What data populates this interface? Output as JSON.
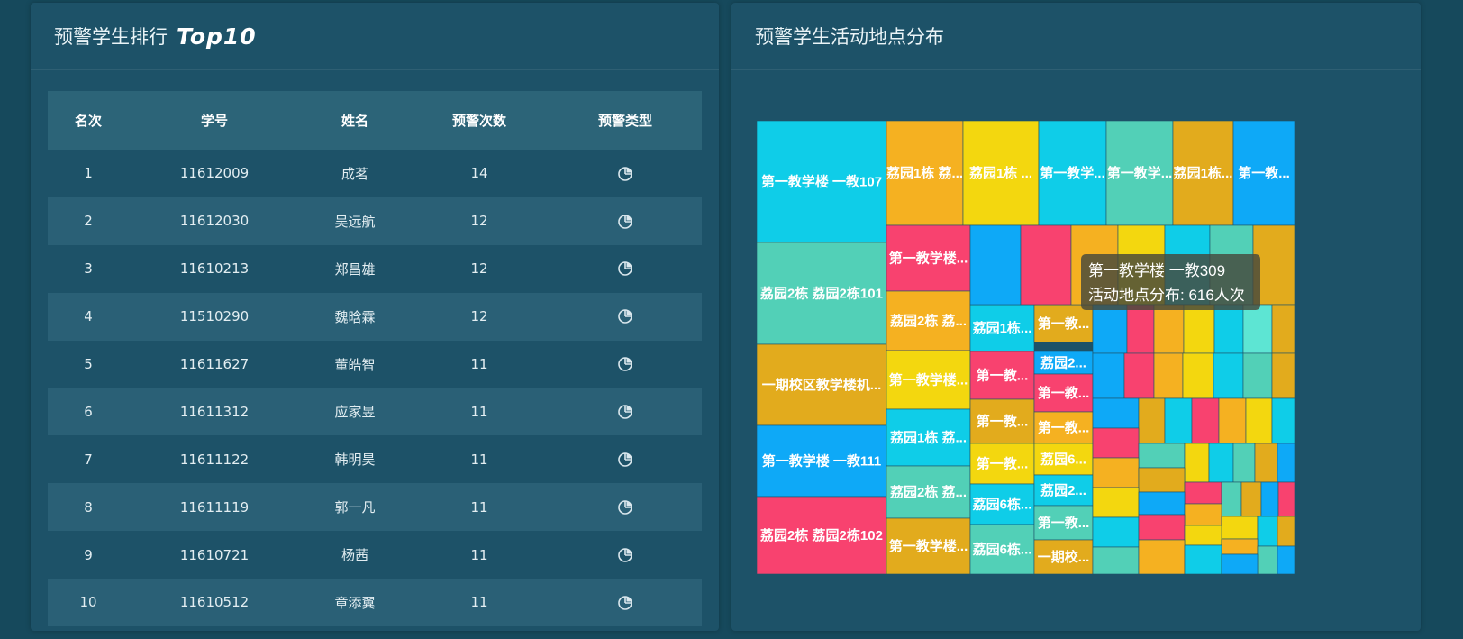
{
  "left_panel": {
    "title": "预警学生排行",
    "title_suffix": "Top10",
    "columns": [
      "名次",
      "学号",
      "姓名",
      "预警次数",
      "预警类型"
    ],
    "rows": [
      {
        "rank": "1",
        "id": "11612009",
        "name": "成茗",
        "count": "14",
        "type_icon": "pie-chart-icon"
      },
      {
        "rank": "2",
        "id": "11612030",
        "name": "吴远航",
        "count": "12",
        "type_icon": "pie-chart-icon"
      },
      {
        "rank": "3",
        "id": "11610213",
        "name": "郑昌雄",
        "count": "12",
        "type_icon": "pie-chart-icon"
      },
      {
        "rank": "4",
        "id": "11510290",
        "name": "魏晗霖",
        "count": "12",
        "type_icon": "pie-chart-icon"
      },
      {
        "rank": "5",
        "id": "11611627",
        "name": "董皓智",
        "count": "11",
        "type_icon": "pie-chart-icon"
      },
      {
        "rank": "6",
        "id": "11611312",
        "name": "应家昱",
        "count": "11",
        "type_icon": "pie-chart-icon"
      },
      {
        "rank": "7",
        "id": "11611122",
        "name": "韩明昊",
        "count": "11",
        "type_icon": "pie-chart-icon"
      },
      {
        "rank": "8",
        "id": "11611119",
        "name": "郭一凡",
        "count": "11",
        "type_icon": "pie-chart-icon"
      },
      {
        "rank": "9",
        "id": "11610721",
        "name": "杨茜",
        "count": "11",
        "type_icon": "pie-chart-icon"
      },
      {
        "rank": "10",
        "id": "11610512",
        "name": "章添翼",
        "count": "11",
        "type_icon": "pie-chart-icon"
      }
    ]
  },
  "right_panel": {
    "title": "预警学生活动地点分布",
    "tooltip": {
      "line1": "第一教学楼 一教309",
      "line2": "活动地点分布: 616人次"
    }
  },
  "colors": {
    "background": "#16495c",
    "panel": "#1d5268",
    "palette": [
      "#0fcde8",
      "#52d0b7",
      "#e2ab1d",
      "#0ea9f7",
      "#f8426f",
      "#f5b121",
      "#f3d70f",
      "#5de5d3"
    ]
  },
  "chart_data": {
    "type": "treemap",
    "series_label": "活动地点分布",
    "unit": "人次",
    "labeled_tiles": [
      {
        "label": "第一教学楼 一教107",
        "color": "#0fcde8"
      },
      {
        "label": "荔园2栋 荔园2栋101",
        "color": "#52d0b7"
      },
      {
        "label": "一期校区教学楼机...",
        "color": "#e2ab1d"
      },
      {
        "label": "第一教学楼 一教111",
        "color": "#0ea9f7"
      },
      {
        "label": "荔园2栋 荔园2栋102",
        "color": "#f8426f"
      },
      {
        "label": "荔园1栋 荔...",
        "color": "#f5b121"
      },
      {
        "label": "荔园1栋 ...",
        "color": "#f3d70f"
      },
      {
        "label": "第一教学...",
        "color": "#0fcde8"
      },
      {
        "label": "第一教学...",
        "color": "#52d0b7"
      },
      {
        "label": "荔园1栋...",
        "color": "#e2ab1d"
      },
      {
        "label": "第一教...",
        "color": "#0ea9f7"
      },
      {
        "label": "第一教学楼...",
        "color": "#f8426f"
      },
      {
        "label": "荔园2栋 荔...",
        "color": "#f5b121"
      },
      {
        "label": "第一教学楼...",
        "color": "#f3d70f"
      },
      {
        "label": "荔园1栋 荔...",
        "color": "#0fcde8"
      },
      {
        "label": "荔园2栋 荔...",
        "color": "#52d0b7"
      },
      {
        "label": "第一教学楼...",
        "color": "#e2ab1d"
      },
      {
        "label": "荔园1栋...",
        "color": "#0fcde8"
      },
      {
        "label": "第一教...",
        "color": "#f8426f"
      },
      {
        "label": "第一教...",
        "color": "#e2ab1d"
      },
      {
        "label": "第一教...",
        "color": "#f3d70f"
      },
      {
        "label": "荔园6栋...",
        "color": "#0fcde8"
      },
      {
        "label": "荔园6栋...",
        "color": "#52d0b7"
      },
      {
        "label": "第一教...",
        "color": "#e2ab1d"
      },
      {
        "label": "荔园2...",
        "color": "#0ea9f7"
      },
      {
        "label": "第一教...",
        "color": "#f8426f"
      },
      {
        "label": "第一教...",
        "color": "#f5b121"
      },
      {
        "label": "荔园6...",
        "color": "#f3d70f"
      },
      {
        "label": "荔园2...",
        "color": "#0fcde8"
      },
      {
        "label": "第一教...",
        "color": "#52d0b7"
      },
      {
        "label": "一期校...",
        "color": "#e2ab1d"
      }
    ],
    "highlighted": {
      "name": "第一教学楼 一教309",
      "value": 616
    }
  }
}
